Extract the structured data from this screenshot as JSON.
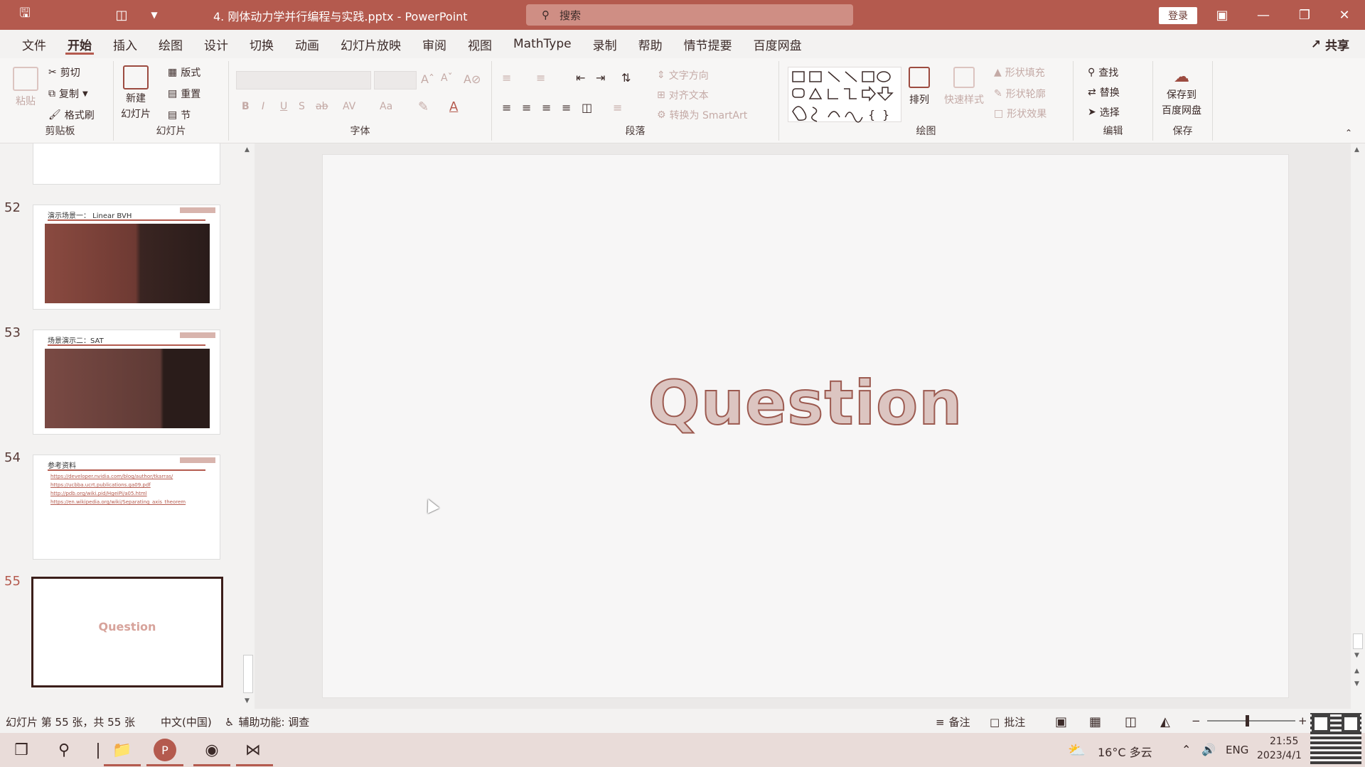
{
  "titlebar": {
    "filename": "4. 刚体动力学并行编程与实践.pptx",
    "separator": "-",
    "app_name": "PowerPoint",
    "search_placeholder": "搜索",
    "login_label": "登录"
  },
  "menu": {
    "tabs": [
      "文件",
      "开始",
      "插入",
      "绘图",
      "设计",
      "切换",
      "动画",
      "幻灯片放映",
      "审阅",
      "视图",
      "MathType",
      "录制",
      "帮助",
      "情节提要",
      "百度网盘"
    ],
    "active_tab": "开始",
    "share_label": "共享"
  },
  "ribbon": {
    "clipboard": {
      "paste": "粘贴",
      "cut": "剪切",
      "copy": "复制",
      "format_painter": "格式刷",
      "label": "剪贴板"
    },
    "slides": {
      "new_slide": "新建",
      "new_slide_2": "幻灯片",
      "layout": "版式",
      "reset": "重置",
      "section": "节",
      "label": "幻灯片"
    },
    "font": {
      "label": "字体",
      "bold": "B",
      "italic": "I",
      "underline": "U",
      "shadow": "S",
      "strike": "ab",
      "spacing": "AV",
      "case": "Aa"
    },
    "paragraph": {
      "label": "段落",
      "text_direction": "文字方向",
      "align_text": "对齐文本",
      "smartart": "转换为 SmartArt"
    },
    "drawing": {
      "label": "绘图",
      "arrange": "排列",
      "quick_styles": "快速样式",
      "shape_fill": "形状填充",
      "shape_outline": "形状轮廓",
      "shape_effects": "形状效果"
    },
    "editing": {
      "label": "编辑",
      "find": "查找",
      "replace": "替换",
      "select": "选择"
    },
    "save": {
      "label": "保存",
      "save_to": "保存到",
      "baidu": "百度网盘"
    }
  },
  "thumbnails": [
    {
      "num": "52",
      "title": "演示场景一：  Linear BVH"
    },
    {
      "num": "53",
      "title": "场景演示二：SAT"
    },
    {
      "num": "54",
      "title": "参考资料",
      "links": [
        "https://developer.nvidia.com/blog/author/tkarras/",
        "https://ucbba.ucrt.publications.ga09.pdf",
        "http://pdb.org/wiki.pid/HgeiPi/a05.html",
        "https://en.wikipedia.org/wiki/Separating_axis_theorem"
      ]
    },
    {
      "num": "55",
      "title": "Question",
      "active": true
    }
  ],
  "slide": {
    "text": "Question"
  },
  "status": {
    "slide_info": "幻灯片 第 55 张，共 55 张",
    "language": "中文(中国)",
    "accessibility": "辅助功能: 调查",
    "notes": "备注",
    "comments": "批注"
  },
  "taskbar": {
    "weather": "16°C  多云",
    "lang": "ENG",
    "time": "21:55",
    "date": "2023/4/1"
  }
}
